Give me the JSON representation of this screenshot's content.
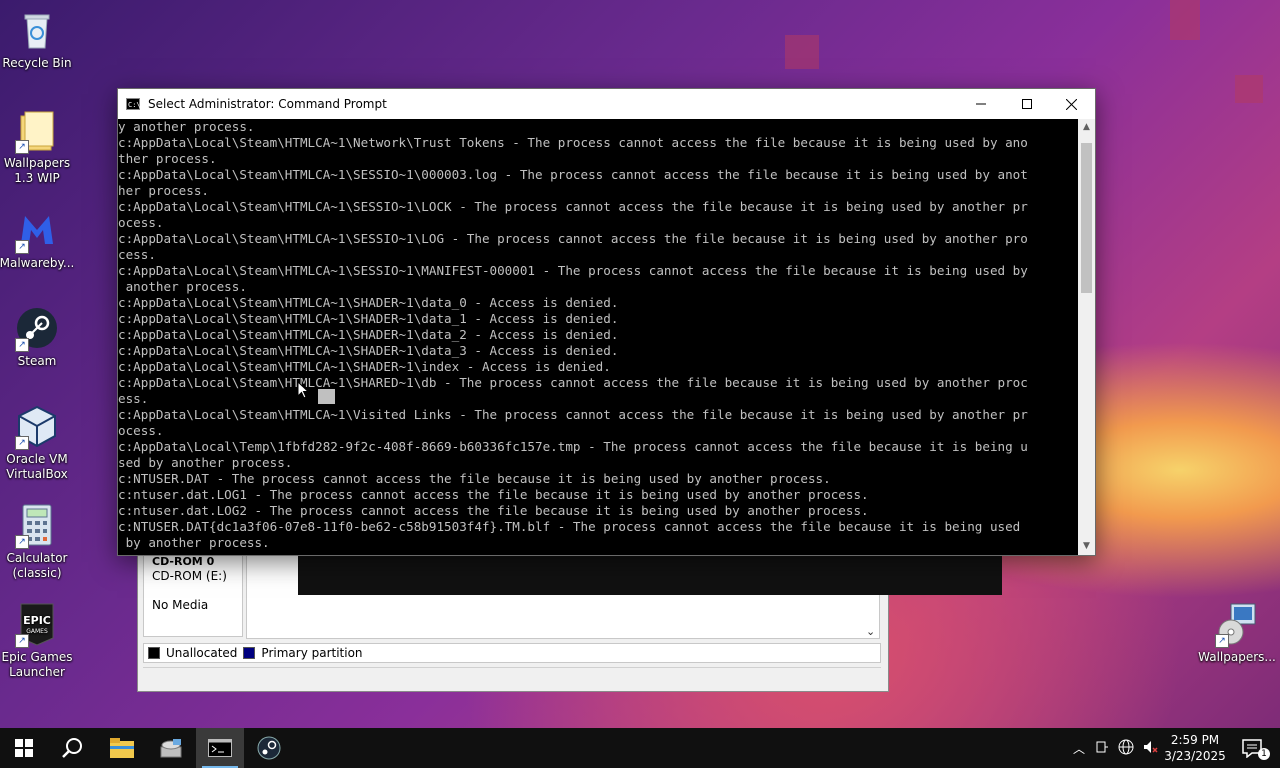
{
  "desktop": {
    "icons": [
      {
        "label": "Recycle Bin",
        "icon": "recycle-bin-icon"
      },
      {
        "label": "Wallpapers 1.3 WIP",
        "icon": "folder-icon"
      },
      {
        "label": "Malwareby...",
        "icon": "malwarebytes-icon"
      },
      {
        "label": "Steam",
        "icon": "steam-icon"
      },
      {
        "label": "Oracle VM VirtualBox",
        "icon": "virtualbox-icon"
      },
      {
        "label": "Calculator (classic)",
        "icon": "calculator-icon"
      },
      {
        "label": "Epic Games Launcher",
        "icon": "epic-games-icon"
      },
      {
        "label": "Wallpapers...",
        "icon": "wallpapers-setup-icon"
      }
    ]
  },
  "disk_management": {
    "disk_header": "CD-ROM 0",
    "drive": "CD-ROM (E:)",
    "media": "No Media",
    "legend": [
      {
        "label": "Unallocated",
        "color": "#000000"
      },
      {
        "label": "Primary partition",
        "color": "#00007f"
      }
    ]
  },
  "cmd": {
    "title": "Select Administrator: Command Prompt",
    "lines": [
      "y another process.",
      "c:AppData\\Local\\Steam\\HTMLCA~1\\Network\\Trust Tokens - The process cannot access the file because it is being used by ano",
      "ther process.",
      "c:AppData\\Local\\Steam\\HTMLCA~1\\SESSIO~1\\000003.log - The process cannot access the file because it is being used by anot",
      "her process.",
      "c:AppData\\Local\\Steam\\HTMLCA~1\\SESSIO~1\\LOCK - The process cannot access the file because it is being used by another pr",
      "ocess.",
      "c:AppData\\Local\\Steam\\HTMLCA~1\\SESSIO~1\\LOG - The process cannot access the file because it is being used by another pro",
      "cess.",
      "c:AppData\\Local\\Steam\\HTMLCA~1\\SESSIO~1\\MANIFEST-000001 - The process cannot access the file because it is being used by",
      " another process.",
      "c:AppData\\Local\\Steam\\HTMLCA~1\\SHADER~1\\data_0 - Access is denied.",
      "c:AppData\\Local\\Steam\\HTMLCA~1\\SHADER~1\\data_1 - Access is denied.",
      "c:AppData\\Local\\Steam\\HTMLCA~1\\SHADER~1\\data_2 - Access is denied.",
      "c:AppData\\Local\\Steam\\HTMLCA~1\\SHADER~1\\data_3 - Access is denied.",
      "c:AppData\\Local\\Steam\\HTMLCA~1\\SHADER~1\\index - Access is denied.",
      "c:AppData\\Local\\Steam\\HTMLCA~1\\SHARED~1\\db - The process cannot access the file because it is being used by another proc",
      "ess.",
      "c:AppData\\Local\\Steam\\HTMLCA~1\\Visited Links - The process cannot access the file because it is being used by another pr",
      "ocess.",
      "c:AppData\\Local\\Temp\\1fbfd282-9f2c-408f-8669-b60336fc157e.tmp - The process cannot access the file because it is being u",
      "sed by another process.",
      "c:NTUSER.DAT - The process cannot access the file because it is being used by another process.",
      "c:ntuser.dat.LOG1 - The process cannot access the file because it is being used by another process.",
      "c:ntuser.dat.LOG2 - The process cannot access the file because it is being used by another process.",
      "c:NTUSER.DAT{dc1a3f06-07e8-11f0-be62-c58b91503f4f}.TM.blf - The process cannot access the file because it is being used",
      " by another process."
    ]
  },
  "taskbar": {
    "items": [
      "start-icon",
      "search-icon",
      "file-explorer-icon",
      "disk-management-icon",
      "command-prompt-icon",
      "steam-icon"
    ],
    "time": "2:59 PM",
    "date": "3/23/2025",
    "notification_count": "1"
  }
}
